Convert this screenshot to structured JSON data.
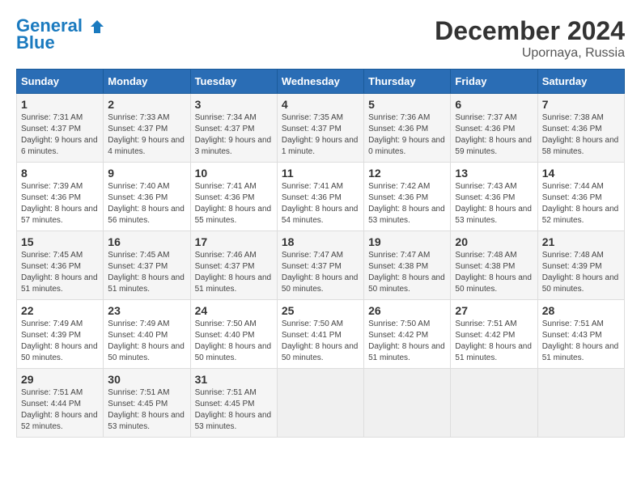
{
  "logo": {
    "line1": "General",
    "line2": "Blue"
  },
  "title": "December 2024",
  "location": "Upornaya, Russia",
  "days_header": [
    "Sunday",
    "Monday",
    "Tuesday",
    "Wednesday",
    "Thursday",
    "Friday",
    "Saturday"
  ],
  "weeks": [
    [
      {
        "day": "1",
        "sunrise": "7:31 AM",
        "sunset": "4:37 PM",
        "daylight": "9 hours and 6 minutes."
      },
      {
        "day": "2",
        "sunrise": "7:33 AM",
        "sunset": "4:37 PM",
        "daylight": "9 hours and 4 minutes."
      },
      {
        "day": "3",
        "sunrise": "7:34 AM",
        "sunset": "4:37 PM",
        "daylight": "9 hours and 3 minutes."
      },
      {
        "day": "4",
        "sunrise": "7:35 AM",
        "sunset": "4:37 PM",
        "daylight": "9 hours and 1 minute."
      },
      {
        "day": "5",
        "sunrise": "7:36 AM",
        "sunset": "4:36 PM",
        "daylight": "9 hours and 0 minutes."
      },
      {
        "day": "6",
        "sunrise": "7:37 AM",
        "sunset": "4:36 PM",
        "daylight": "8 hours and 59 minutes."
      },
      {
        "day": "7",
        "sunrise": "7:38 AM",
        "sunset": "4:36 PM",
        "daylight": "8 hours and 58 minutes."
      }
    ],
    [
      {
        "day": "8",
        "sunrise": "7:39 AM",
        "sunset": "4:36 PM",
        "daylight": "8 hours and 57 minutes."
      },
      {
        "day": "9",
        "sunrise": "7:40 AM",
        "sunset": "4:36 PM",
        "daylight": "8 hours and 56 minutes."
      },
      {
        "day": "10",
        "sunrise": "7:41 AM",
        "sunset": "4:36 PM",
        "daylight": "8 hours and 55 minutes."
      },
      {
        "day": "11",
        "sunrise": "7:41 AM",
        "sunset": "4:36 PM",
        "daylight": "8 hours and 54 minutes."
      },
      {
        "day": "12",
        "sunrise": "7:42 AM",
        "sunset": "4:36 PM",
        "daylight": "8 hours and 53 minutes."
      },
      {
        "day": "13",
        "sunrise": "7:43 AM",
        "sunset": "4:36 PM",
        "daylight": "8 hours and 53 minutes."
      },
      {
        "day": "14",
        "sunrise": "7:44 AM",
        "sunset": "4:36 PM",
        "daylight": "8 hours and 52 minutes."
      }
    ],
    [
      {
        "day": "15",
        "sunrise": "7:45 AM",
        "sunset": "4:36 PM",
        "daylight": "8 hours and 51 minutes."
      },
      {
        "day": "16",
        "sunrise": "7:45 AM",
        "sunset": "4:37 PM",
        "daylight": "8 hours and 51 minutes."
      },
      {
        "day": "17",
        "sunrise": "7:46 AM",
        "sunset": "4:37 PM",
        "daylight": "8 hours and 51 minutes."
      },
      {
        "day": "18",
        "sunrise": "7:47 AM",
        "sunset": "4:37 PM",
        "daylight": "8 hours and 50 minutes."
      },
      {
        "day": "19",
        "sunrise": "7:47 AM",
        "sunset": "4:38 PM",
        "daylight": "8 hours and 50 minutes."
      },
      {
        "day": "20",
        "sunrise": "7:48 AM",
        "sunset": "4:38 PM",
        "daylight": "8 hours and 50 minutes."
      },
      {
        "day": "21",
        "sunrise": "7:48 AM",
        "sunset": "4:39 PM",
        "daylight": "8 hours and 50 minutes."
      }
    ],
    [
      {
        "day": "22",
        "sunrise": "7:49 AM",
        "sunset": "4:39 PM",
        "daylight": "8 hours and 50 minutes."
      },
      {
        "day": "23",
        "sunrise": "7:49 AM",
        "sunset": "4:40 PM",
        "daylight": "8 hours and 50 minutes."
      },
      {
        "day": "24",
        "sunrise": "7:50 AM",
        "sunset": "4:40 PM",
        "daylight": "8 hours and 50 minutes."
      },
      {
        "day": "25",
        "sunrise": "7:50 AM",
        "sunset": "4:41 PM",
        "daylight": "8 hours and 50 minutes."
      },
      {
        "day": "26",
        "sunrise": "7:50 AM",
        "sunset": "4:42 PM",
        "daylight": "8 hours and 51 minutes."
      },
      {
        "day": "27",
        "sunrise": "7:51 AM",
        "sunset": "4:42 PM",
        "daylight": "8 hours and 51 minutes."
      },
      {
        "day": "28",
        "sunrise": "7:51 AM",
        "sunset": "4:43 PM",
        "daylight": "8 hours and 51 minutes."
      }
    ],
    [
      {
        "day": "29",
        "sunrise": "7:51 AM",
        "sunset": "4:44 PM",
        "daylight": "8 hours and 52 minutes."
      },
      {
        "day": "30",
        "sunrise": "7:51 AM",
        "sunset": "4:45 PM",
        "daylight": "8 hours and 53 minutes."
      },
      {
        "day": "31",
        "sunrise": "7:51 AM",
        "sunset": "4:45 PM",
        "daylight": "8 hours and 53 minutes."
      },
      null,
      null,
      null,
      null
    ]
  ],
  "labels": {
    "sunrise": "Sunrise:",
    "sunset": "Sunset:",
    "daylight": "Daylight:"
  }
}
